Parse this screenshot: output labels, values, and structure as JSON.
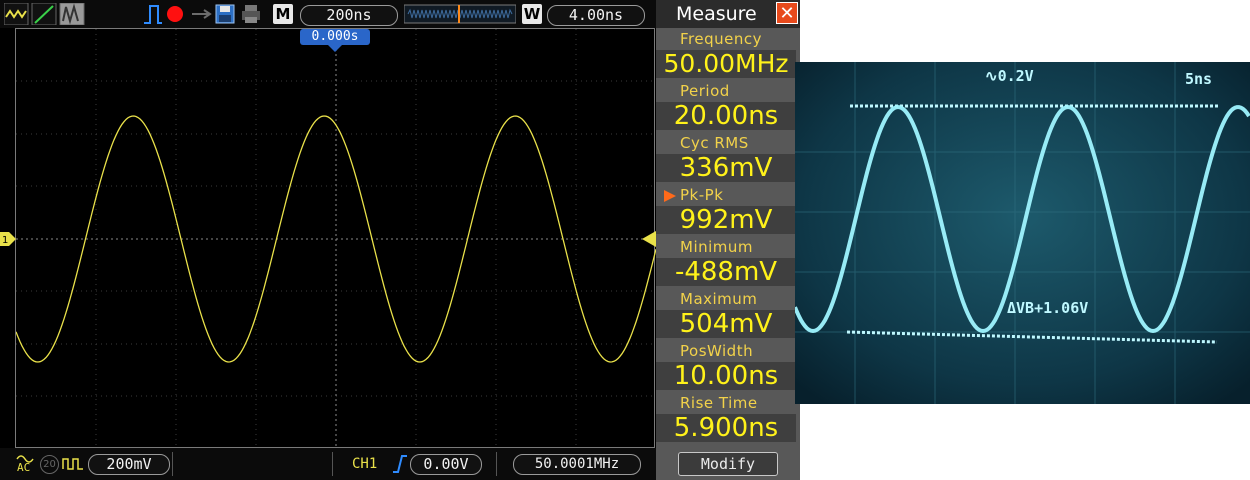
{
  "toolbar": {
    "timebase": "200ns",
    "m_label": "M",
    "w_label": "W",
    "window_time": "4.00ns"
  },
  "screen": {
    "trigger_position": "0.000s",
    "channel_marker": "1"
  },
  "bottom": {
    "coupling": "AC",
    "bw_limit": "20",
    "volts_div": "200mV",
    "trigger_source": "CH1",
    "trigger_level": "0.00V",
    "frequency": "50.0001MHz"
  },
  "measure": {
    "title": "Measure",
    "items": [
      {
        "label": "Frequency",
        "value": "50.00MHz",
        "selected": false
      },
      {
        "label": "Period",
        "value": "20.00ns",
        "selected": false
      },
      {
        "label": "Cyc RMS",
        "value": "336mV",
        "selected": false
      },
      {
        "label": "Pk-Pk",
        "value": "992mV",
        "selected": true
      },
      {
        "label": "Minimum",
        "value": "-488mV",
        "selected": false
      },
      {
        "label": "Maximum",
        "value": "504mV",
        "selected": false
      },
      {
        "label": "PosWidth",
        "value": "10.00ns",
        "selected": false
      },
      {
        "label": "Rise Time",
        "value": "5.900ns",
        "selected": false
      }
    ],
    "modify_label": "Modify"
  },
  "photo": {
    "volts_label": "∿0.2V",
    "time_label": "5ns",
    "delta_label": "ΔVB+1.06V"
  },
  "colors": {
    "trace": "#e9e14a",
    "value_text": "#fff21a",
    "label_text": "#f2d24a",
    "analog_trace": "#9ff4ff",
    "analog_bg": "#0c3a4a"
  }
}
